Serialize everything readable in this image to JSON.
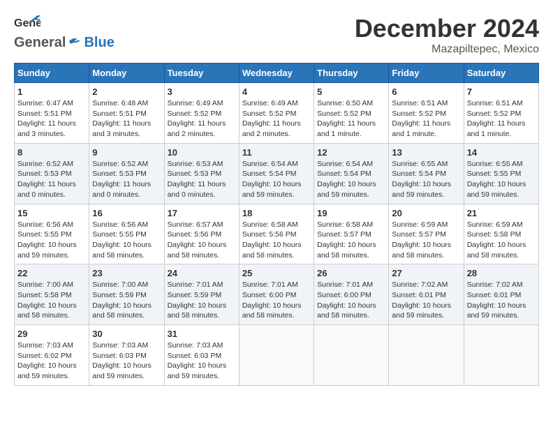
{
  "header": {
    "logo_line1": "General",
    "logo_line2": "Blue",
    "month_title": "December 2024",
    "location": "Mazapiltepec, Mexico"
  },
  "weekdays": [
    "Sunday",
    "Monday",
    "Tuesday",
    "Wednesday",
    "Thursday",
    "Friday",
    "Saturday"
  ],
  "weeks": [
    [
      {
        "day": "1",
        "info": "Sunrise: 6:47 AM\nSunset: 5:51 PM\nDaylight: 11 hours\nand 3 minutes."
      },
      {
        "day": "2",
        "info": "Sunrise: 6:48 AM\nSunset: 5:51 PM\nDaylight: 11 hours\nand 3 minutes."
      },
      {
        "day": "3",
        "info": "Sunrise: 6:49 AM\nSunset: 5:52 PM\nDaylight: 11 hours\nand 2 minutes."
      },
      {
        "day": "4",
        "info": "Sunrise: 6:49 AM\nSunset: 5:52 PM\nDaylight: 11 hours\nand 2 minutes."
      },
      {
        "day": "5",
        "info": "Sunrise: 6:50 AM\nSunset: 5:52 PM\nDaylight: 11 hours\nand 1 minute."
      },
      {
        "day": "6",
        "info": "Sunrise: 6:51 AM\nSunset: 5:52 PM\nDaylight: 11 hours\nand 1 minute."
      },
      {
        "day": "7",
        "info": "Sunrise: 6:51 AM\nSunset: 5:52 PM\nDaylight: 11 hours\nand 1 minute."
      }
    ],
    [
      {
        "day": "8",
        "info": "Sunrise: 6:52 AM\nSunset: 5:53 PM\nDaylight: 11 hours\nand 0 minutes."
      },
      {
        "day": "9",
        "info": "Sunrise: 6:52 AM\nSunset: 5:53 PM\nDaylight: 11 hours\nand 0 minutes."
      },
      {
        "day": "10",
        "info": "Sunrise: 6:53 AM\nSunset: 5:53 PM\nDaylight: 11 hours\nand 0 minutes."
      },
      {
        "day": "11",
        "info": "Sunrise: 6:54 AM\nSunset: 5:54 PM\nDaylight: 10 hours\nand 59 minutes."
      },
      {
        "day": "12",
        "info": "Sunrise: 6:54 AM\nSunset: 5:54 PM\nDaylight: 10 hours\nand 59 minutes."
      },
      {
        "day": "13",
        "info": "Sunrise: 6:55 AM\nSunset: 5:54 PM\nDaylight: 10 hours\nand 59 minutes."
      },
      {
        "day": "14",
        "info": "Sunrise: 6:55 AM\nSunset: 5:55 PM\nDaylight: 10 hours\nand 59 minutes."
      }
    ],
    [
      {
        "day": "15",
        "info": "Sunrise: 6:56 AM\nSunset: 5:55 PM\nDaylight: 10 hours\nand 59 minutes."
      },
      {
        "day": "16",
        "info": "Sunrise: 6:56 AM\nSunset: 5:55 PM\nDaylight: 10 hours\nand 58 minutes."
      },
      {
        "day": "17",
        "info": "Sunrise: 6:57 AM\nSunset: 5:56 PM\nDaylight: 10 hours\nand 58 minutes."
      },
      {
        "day": "18",
        "info": "Sunrise: 6:58 AM\nSunset: 5:56 PM\nDaylight: 10 hours\nand 58 minutes."
      },
      {
        "day": "19",
        "info": "Sunrise: 6:58 AM\nSunset: 5:57 PM\nDaylight: 10 hours\nand 58 minutes."
      },
      {
        "day": "20",
        "info": "Sunrise: 6:59 AM\nSunset: 5:57 PM\nDaylight: 10 hours\nand 58 minutes."
      },
      {
        "day": "21",
        "info": "Sunrise: 6:59 AM\nSunset: 5:58 PM\nDaylight: 10 hours\nand 58 minutes."
      }
    ],
    [
      {
        "day": "22",
        "info": "Sunrise: 7:00 AM\nSunset: 5:58 PM\nDaylight: 10 hours\nand 58 minutes."
      },
      {
        "day": "23",
        "info": "Sunrise: 7:00 AM\nSunset: 5:59 PM\nDaylight: 10 hours\nand 58 minutes."
      },
      {
        "day": "24",
        "info": "Sunrise: 7:01 AM\nSunset: 5:59 PM\nDaylight: 10 hours\nand 58 minutes."
      },
      {
        "day": "25",
        "info": "Sunrise: 7:01 AM\nSunset: 6:00 PM\nDaylight: 10 hours\nand 58 minutes."
      },
      {
        "day": "26",
        "info": "Sunrise: 7:01 AM\nSunset: 6:00 PM\nDaylight: 10 hours\nand 58 minutes."
      },
      {
        "day": "27",
        "info": "Sunrise: 7:02 AM\nSunset: 6:01 PM\nDaylight: 10 hours\nand 59 minutes."
      },
      {
        "day": "28",
        "info": "Sunrise: 7:02 AM\nSunset: 6:01 PM\nDaylight: 10 hours\nand 59 minutes."
      }
    ],
    [
      {
        "day": "29",
        "info": "Sunrise: 7:03 AM\nSunset: 6:02 PM\nDaylight: 10 hours\nand 59 minutes."
      },
      {
        "day": "30",
        "info": "Sunrise: 7:03 AM\nSunset: 6:03 PM\nDaylight: 10 hours\nand 59 minutes."
      },
      {
        "day": "31",
        "info": "Sunrise: 7:03 AM\nSunset: 6:03 PM\nDaylight: 10 hours\nand 59 minutes."
      },
      {
        "day": "",
        "info": ""
      },
      {
        "day": "",
        "info": ""
      },
      {
        "day": "",
        "info": ""
      },
      {
        "day": "",
        "info": ""
      }
    ]
  ]
}
